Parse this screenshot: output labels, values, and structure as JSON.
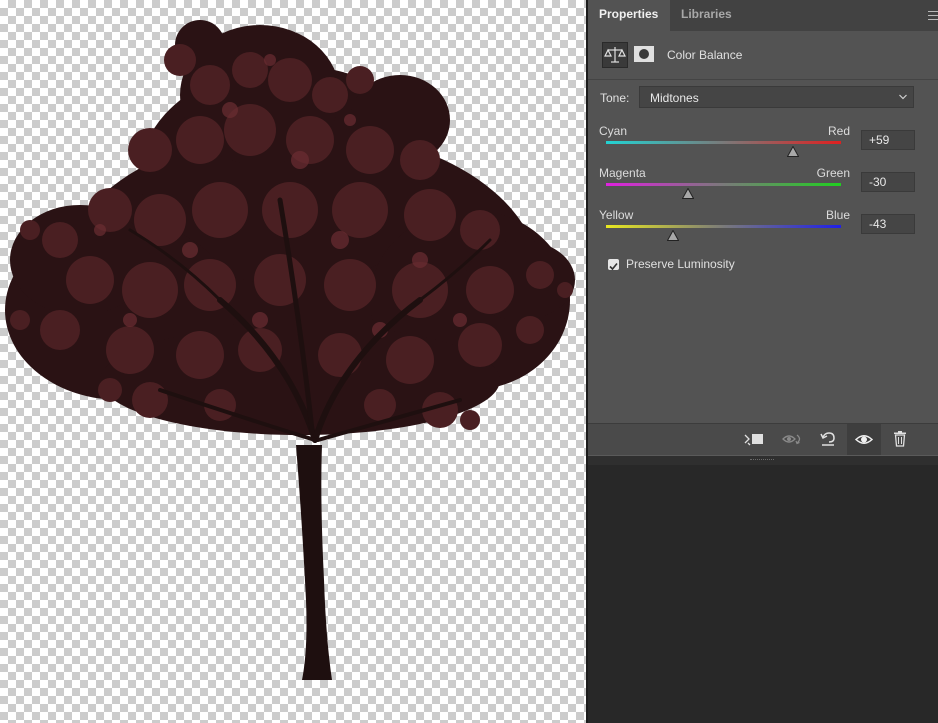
{
  "tabs": [
    {
      "label": "Properties",
      "active": true
    },
    {
      "label": "Libraries",
      "active": false
    }
  ],
  "header": {
    "title": "Color Balance",
    "adjustment_icon": "balance-scale-icon",
    "mask_icon": "layer-mask-icon"
  },
  "tone": {
    "label": "Tone:",
    "value": "Midtones"
  },
  "sliders": [
    {
      "left": "Cyan",
      "right": "Red",
      "value": "+59",
      "level": 59,
      "min": -100,
      "max": 100,
      "gradient_from": "#22d3d3",
      "gradient_to": "#e02020"
    },
    {
      "left": "Magenta",
      "right": "Green",
      "value": "-30",
      "level": -30,
      "min": -100,
      "max": 100,
      "gradient_from": "#e020e0",
      "gradient_to": "#20d020"
    },
    {
      "left": "Yellow",
      "right": "Blue",
      "value": "-43",
      "level": -43,
      "min": -100,
      "max": 100,
      "gradient_from": "#e8e820",
      "gradient_to": "#2020e8"
    }
  ],
  "preserve_luminosity": {
    "label": "Preserve Luminosity",
    "checked": true
  },
  "footer_icons": [
    "clip-to-layer-icon",
    "view-previous-state-icon",
    "reset-icon",
    "visibility-eye-icon",
    "trash-icon"
  ],
  "colors": {
    "panel_bg": "#535353",
    "tab_bar_bg": "#424242",
    "canvas_check": "#cccccc",
    "tree_foliage": "#3e1a1c",
    "tree_trunk": "#1e0f0f"
  }
}
